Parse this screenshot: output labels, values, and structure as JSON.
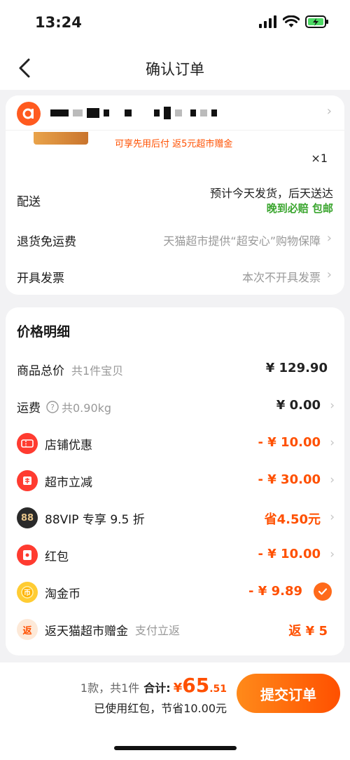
{
  "status": {
    "time": "13:24"
  },
  "nav": {
    "title": "确认订单"
  },
  "product": {
    "promo": "可享先用后付   返5元超市赠金",
    "qty": "×1"
  },
  "delivery": {
    "label": "配送",
    "eta": "预计今天发货，后天送达",
    "guarantee": "晚到必赔  包邮"
  },
  "returns": {
    "label": "退货免运费",
    "value": "天猫超市提供“超安心”购物保障"
  },
  "invoice": {
    "label": "开具发票",
    "value": "本次不开具发票"
  },
  "price": {
    "title": "价格明细",
    "rows": [
      {
        "label": "商品总价",
        "sub": "共1件宝贝",
        "value": "¥ 129.90"
      },
      {
        "label": "运费",
        "sub": "共0.90kg",
        "value": "¥ 0.00"
      },
      {
        "label": "店铺优惠",
        "value": "- ¥ 10.00"
      },
      {
        "label": "超市立减",
        "value": "- ¥ 30.00"
      },
      {
        "label": "88VIP 专享 9.5 折",
        "value": "省4.50元"
      },
      {
        "label": "红包",
        "value": "- ¥ 10.00"
      },
      {
        "label": "淘金币",
        "value": "- ¥ 9.89"
      },
      {
        "label": "返天猫超市赠金",
        "sub": "支付立返",
        "value": "返 ¥ 5"
      }
    ],
    "icons": {
      "shop": "返",
      "vip": "88",
      "rebate": "返"
    }
  },
  "summary": {
    "count": "1款，共1件",
    "total_label": "合计:",
    "yen": "¥",
    "int": "65",
    "dec": ".51",
    "saved": "已使用红包，节省10.00元",
    "submit": "提交订单"
  },
  "colors": {
    "accent": "#ff5000",
    "green": "#3aa52e"
  }
}
